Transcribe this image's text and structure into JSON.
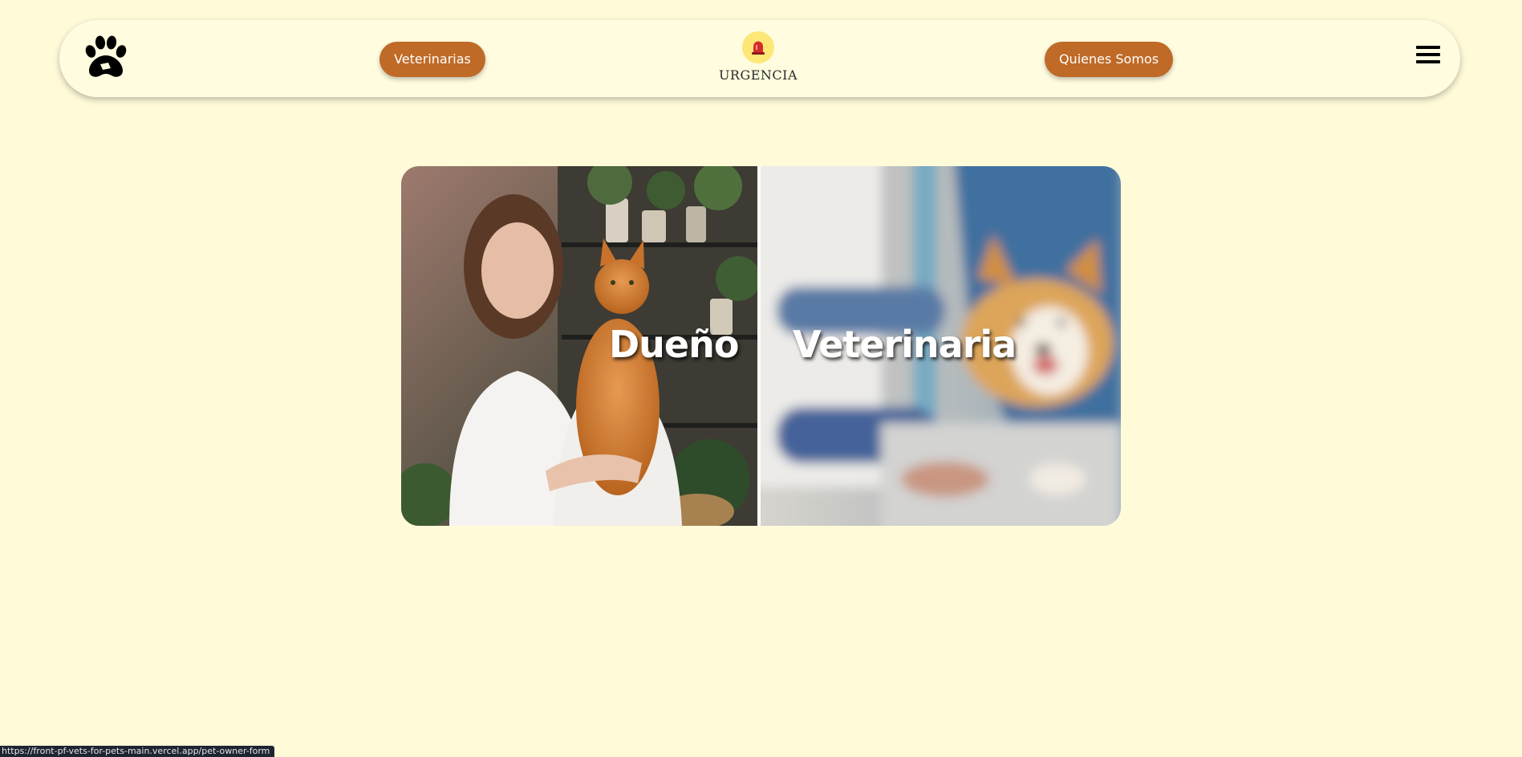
{
  "nav": {
    "logo_icon": "paw-print-icon",
    "vets_label": "Veterinarias",
    "urgencia_icon": "siren-icon",
    "urgencia_label": "URGENCIA",
    "about_label": "Quienes Somos",
    "menu_icon": "hamburger-menu-icon"
  },
  "cards": {
    "owner_label": "Dueño",
    "vet_label": "Veterinaria"
  },
  "status_bar": {
    "url": "https://front-pf-vets-for-pets-main.vercel.app/pet-owner-form"
  },
  "colors": {
    "background": "#fffbd9",
    "navbar": "#fffce0",
    "button": "#bf6a26",
    "siren_circle": "#fde776"
  }
}
